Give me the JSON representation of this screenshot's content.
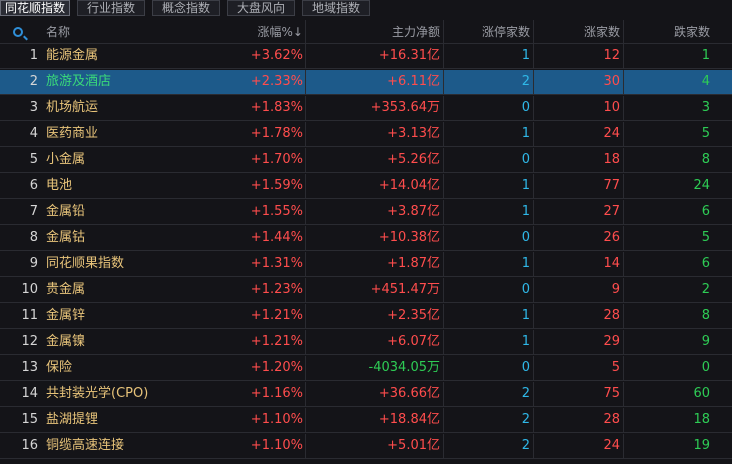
{
  "tabs": [
    {
      "label": "同花顺指数",
      "active": true
    },
    {
      "label": "行业指数",
      "active": false
    },
    {
      "label": "概念指数",
      "active": false
    },
    {
      "label": "大盘风向",
      "active": false
    },
    {
      "label": "地域指数",
      "active": false
    }
  ],
  "columns": {
    "name": "名称",
    "change": "涨幅%↓",
    "net_flow": "主力净额",
    "limit_up": "涨停家数",
    "up": "涨家数",
    "down": "跌家数"
  },
  "rows": [
    {
      "idx": "1",
      "name": "能源金属",
      "change": "+3.62%",
      "net_flow": "+16.31亿",
      "limit_up": "1",
      "up": "12",
      "down": "1"
    },
    {
      "idx": "2",
      "name": "旅游及酒店",
      "change": "+2.33%",
      "net_flow": "+6.11亿",
      "limit_up": "2",
      "up": "30",
      "down": "4"
    },
    {
      "idx": "3",
      "name": "机场航运",
      "change": "+1.83%",
      "net_flow": "+353.64万",
      "limit_up": "0",
      "up": "10",
      "down": "3"
    },
    {
      "idx": "4",
      "name": "医药商业",
      "change": "+1.78%",
      "net_flow": "+3.13亿",
      "limit_up": "1",
      "up": "24",
      "down": "5"
    },
    {
      "idx": "5",
      "name": "小金属",
      "change": "+1.70%",
      "net_flow": "+5.26亿",
      "limit_up": "0",
      "up": "18",
      "down": "8"
    },
    {
      "idx": "6",
      "name": "电池",
      "change": "+1.59%",
      "net_flow": "+14.04亿",
      "limit_up": "1",
      "up": "77",
      "down": "24"
    },
    {
      "idx": "7",
      "name": "金属铅",
      "change": "+1.55%",
      "net_flow": "+3.87亿",
      "limit_up": "1",
      "up": "27",
      "down": "6"
    },
    {
      "idx": "8",
      "name": "金属钴",
      "change": "+1.44%",
      "net_flow": "+10.38亿",
      "limit_up": "0",
      "up": "26",
      "down": "5"
    },
    {
      "idx": "9",
      "name": "同花顺果指数",
      "change": "+1.31%",
      "net_flow": "+1.87亿",
      "limit_up": "1",
      "up": "14",
      "down": "6"
    },
    {
      "idx": "10",
      "name": "贵金属",
      "change": "+1.23%",
      "net_flow": "+451.47万",
      "limit_up": "0",
      "up": "9",
      "down": "2"
    },
    {
      "idx": "11",
      "name": "金属锌",
      "change": "+1.21%",
      "net_flow": "+2.35亿",
      "limit_up": "1",
      "up": "28",
      "down": "8"
    },
    {
      "idx": "12",
      "name": "金属镍",
      "change": "+1.21%",
      "net_flow": "+6.07亿",
      "limit_up": "1",
      "up": "29",
      "down": "9"
    },
    {
      "idx": "13",
      "name": "保险",
      "change": "+1.20%",
      "net_flow": "-4034.05万",
      "limit_up": "0",
      "up": "5",
      "down": "0"
    },
    {
      "idx": "14",
      "name": "共封装光学(CPO)",
      "change": "+1.16%",
      "net_flow": "+36.66亿",
      "limit_up": "2",
      "up": "75",
      "down": "60"
    },
    {
      "idx": "15",
      "name": "盐湖提锂",
      "change": "+1.10%",
      "net_flow": "+18.84亿",
      "limit_up": "2",
      "up": "28",
      "down": "18"
    },
    {
      "idx": "16",
      "name": "铜缆高速连接",
      "change": "+1.10%",
      "net_flow": "+5.01亿",
      "limit_up": "2",
      "up": "24",
      "down": "19"
    }
  ],
  "selected_row": 2,
  "colors": {
    "up": "#ff4d4d",
    "down": "#2ecc55",
    "neutral": "#2fb8e8",
    "selected": "#1d5a8a",
    "name": "#e8c47a"
  }
}
